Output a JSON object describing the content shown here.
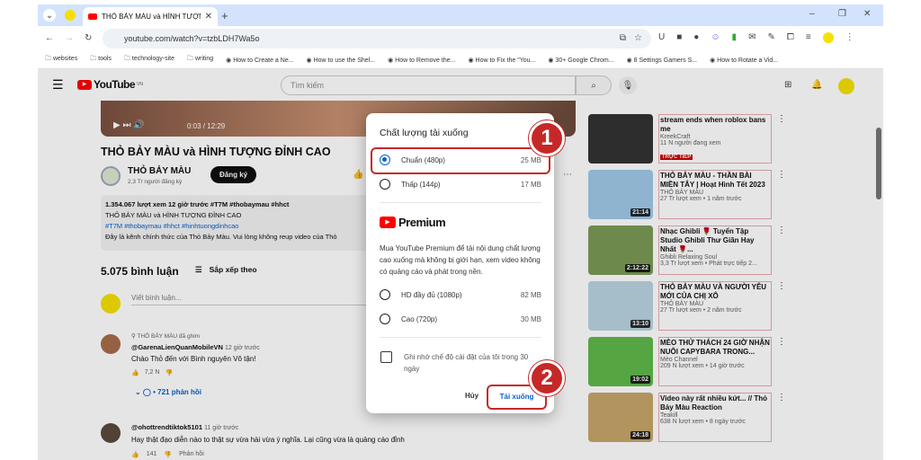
{
  "browser": {
    "tab_title": "THỎ BẢY MÀU và HÌNH TƯỢNG",
    "url": "youtube.com/watch?v=tzbLDH7Wa5o",
    "bookmarks": [
      "websites",
      "tools",
      "technology-site",
      "writing",
      "How to Create a Ne...",
      "How to use the Shel...",
      "How to Remove the...",
      "How to Fix the \"You...",
      "30+ Google Chrom...",
      "8 Settings Gamers S...",
      "How to Rotate a Vid..."
    ]
  },
  "yt": {
    "logo": "YouTube",
    "country": "VN",
    "search_placeholder": "Tìm kiếm",
    "time": "0:03 / 12:29",
    "video_title": "THỎ BẢY MÀU và HÌNH TƯỢNG ĐỈNH CAO",
    "channel": "THỎ BẢY MÀU",
    "subs": "2,3 Tr người đăng ký",
    "subscribe": "Đăng ký",
    "desc": [
      "1.354.067 lượt xem  12 giờ trước  #T7M #thobaymau #hhct",
      "THỎ BẢY MÀU và HÌNH TƯỢNG ĐỈNH CAO",
      "#T7M #thobaymau #hhct #hinhtuongdinhcao",
      "Đây là kênh chính thức của Thỏ Bảy Màu. Vui lòng không reup video của Thỏ"
    ],
    "comment_count": "5.075 bình luận",
    "sort": "Sắp xếp theo",
    "comment_placeholder": "Viết bình luận...",
    "comments": [
      {
        "pinned": "THỎ BẢY MÀU đã ghim",
        "author": "@GarenaLienQuanMobileVN",
        "time": "12 giờ trước",
        "text": "Chào Thỏ đến với Bình nguyên Vô tận!",
        "likes": "7,2 N",
        "replies": "721 phản hồi"
      },
      {
        "author": "@ohottrendtiktok5101",
        "time": "11 giờ trước",
        "text": "Hay thật  đạo diễn nào to thật sự  vừa hài vừa ý nghĩa. Lại cũng vừa là quảng cáo  đỉnh",
        "likes": "141",
        "reply": "Phản hồi"
      }
    ],
    "related": [
      {
        "title": "stream ends when roblox bans me",
        "channel": "KreekCraft",
        "meta": "11 N người đang xem",
        "badge": "TRỰC TIẾP",
        "color": "#333"
      },
      {
        "title": "THỎ BẢY MÀU - THẦN BÀI MIỀN TÂY | Hoạt Hình Tết 2023",
        "channel": "THỎ BẢY MÀU",
        "meta": "27 Tr lượt xem • 1 năm trước",
        "dur": "21:14",
        "color": "#9fc9e8"
      },
      {
        "title": "Nhạc Ghibli 🌹 Tuyển Tập Studio Ghibli Thư Giãn Hay Nhất 🌹...",
        "channel": "Ghibli Relaxing Soul",
        "meta": "3,3 Tr lượt xem • Phát trực tiếp 2...",
        "dur": "2:12:22",
        "color": "#7a9a55"
      },
      {
        "title": "THỎ BẢY MÀU VÀ NGƯỜI YÊU MỚI CỦA CHỊ XÔ",
        "channel": "THỎ BẢY MÀU",
        "meta": "27 Tr lượt xem • 2 năm trước",
        "dur": "13:10",
        "color": "#b8d4e0"
      },
      {
        "title": "MÈO THỬ THÁCH 24 GIỜ NHẬN NUÔI CAPYBARA TRONG...",
        "channel": "Mèo Channel",
        "meta": "209 N lượt xem • 14 giờ trước",
        "dur": "19:02",
        "color": "#5fb84a"
      },
      {
        "title": "Video này rất nhiều kứt... // Thỏ Bảy Màu Reaction",
        "channel": "Teakill",
        "meta": "638 N lượt xem • 8 ngày trước",
        "dur": "24:18",
        "color": "#c7a56a"
      }
    ]
  },
  "dialog": {
    "title": "Chất lượng tải xuống",
    "options": [
      {
        "label": "Chuẩn (480p)",
        "size": "25 MB",
        "selected": true
      },
      {
        "label": "Thấp (144p)",
        "size": "17 MB"
      }
    ],
    "premium_logo": "Premium",
    "premium_text": "Mua YouTube Premium để tải nội dung chất lượng cao xuống mà không bị giới hạn, xem video không có quảng cáo và phát trong nền.",
    "premium_options": [
      {
        "label": "HD đầy đủ (1080p)",
        "size": "82 MB"
      },
      {
        "label": "Cao (720p)",
        "size": "30 MB"
      }
    ],
    "remember": "Ghi nhớ chế độ cài đặt của tôi trong 30 ngày",
    "cancel": "Hủy",
    "download": "Tải xuống"
  },
  "annotations": [
    "1",
    "2"
  ],
  "colors": {
    "accent": "#065fd4",
    "annotation": "#c62828",
    "yt_red": "#ff0000"
  }
}
